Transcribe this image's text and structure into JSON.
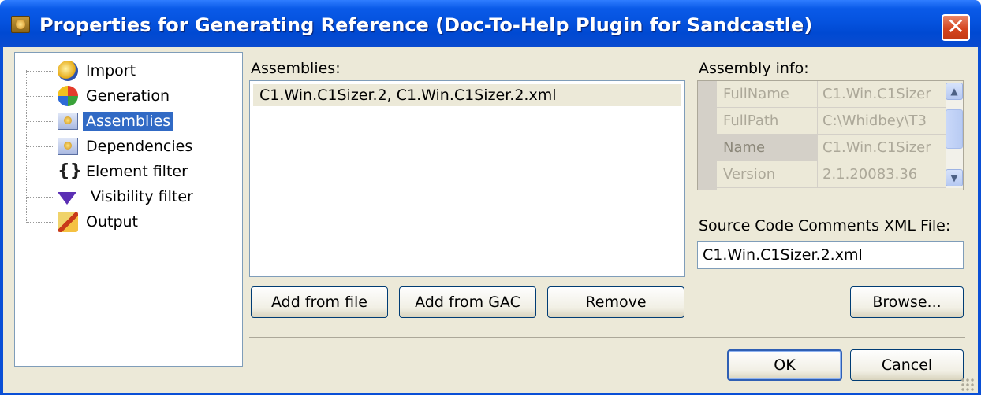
{
  "window": {
    "title": "Properties for Generating Reference (Doc-To-Help Plugin for Sandcastle)",
    "close_glyph": "✕"
  },
  "tree": {
    "items": [
      {
        "label": "Import",
        "icon": "import-icon"
      },
      {
        "label": "Generation",
        "icon": "generation-icon"
      },
      {
        "label": "Assemblies",
        "icon": "assembly-icon",
        "selected": true
      },
      {
        "label": "Dependencies",
        "icon": "assembly-icon"
      },
      {
        "label": "Element filter",
        "icon": "braces-icon"
      },
      {
        "label": "Visibility filter",
        "icon": "funnel-icon"
      },
      {
        "label": "Output",
        "icon": "output-icon"
      }
    ]
  },
  "assemblies": {
    "label": "Assemblies:",
    "items": [
      "C1.Win.C1Sizer.2, C1.Win.C1Sizer.2.xml"
    ],
    "buttons": {
      "add_from_file": "Add from file",
      "add_from_gac": "Add from GAC",
      "remove": "Remove"
    }
  },
  "assembly_info": {
    "label": "Assembly info:",
    "rows": [
      {
        "key": "FullName",
        "value": "C1.Win.C1Sizer"
      },
      {
        "key": "FullPath",
        "value": "C:\\Whidbey\\T3"
      },
      {
        "key": "Name",
        "value": "C1.Win.C1Sizer"
      },
      {
        "key": "Version",
        "value": "2.1.20083.36"
      }
    ]
  },
  "source": {
    "label": "Source Code Comments XML File:",
    "value": "C1.Win.C1Sizer.2.xml",
    "browse_label": "Browse..."
  },
  "footer": {
    "ok_label": "OK",
    "cancel_label": "Cancel"
  },
  "colors": {
    "title_bar": "#0553df",
    "selection": "#316ac5",
    "dialog_face": "#ece9d8"
  }
}
